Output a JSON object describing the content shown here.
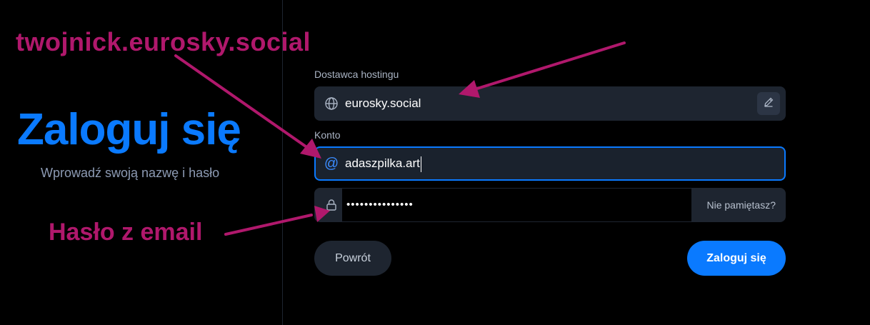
{
  "left_panel": {
    "title": "Zaloguj się",
    "subtitle": "Wprowadź swoją nazwę i hasło"
  },
  "form": {
    "hosting_label": "Dostawca hostingu",
    "hosting_value": "eurosky.social",
    "account_label": "Konto",
    "account_value": "adaszpilka.art",
    "password_value": "•••••••••••••••",
    "forgot_label": "Nie pamiętasz?"
  },
  "buttons": {
    "back": "Powrót",
    "login": "Zaloguj się"
  },
  "annotations": {
    "handle_note": "twojnick.eurosky.social",
    "password_note": "Hasło z email"
  },
  "colors": {
    "accent": "#0a7aff",
    "annotation": "#b0186c",
    "field_bg": "#1e2530",
    "background": "#000000"
  },
  "icons": [
    "globe-icon",
    "pencil-icon",
    "at-icon",
    "lock-icon"
  ]
}
